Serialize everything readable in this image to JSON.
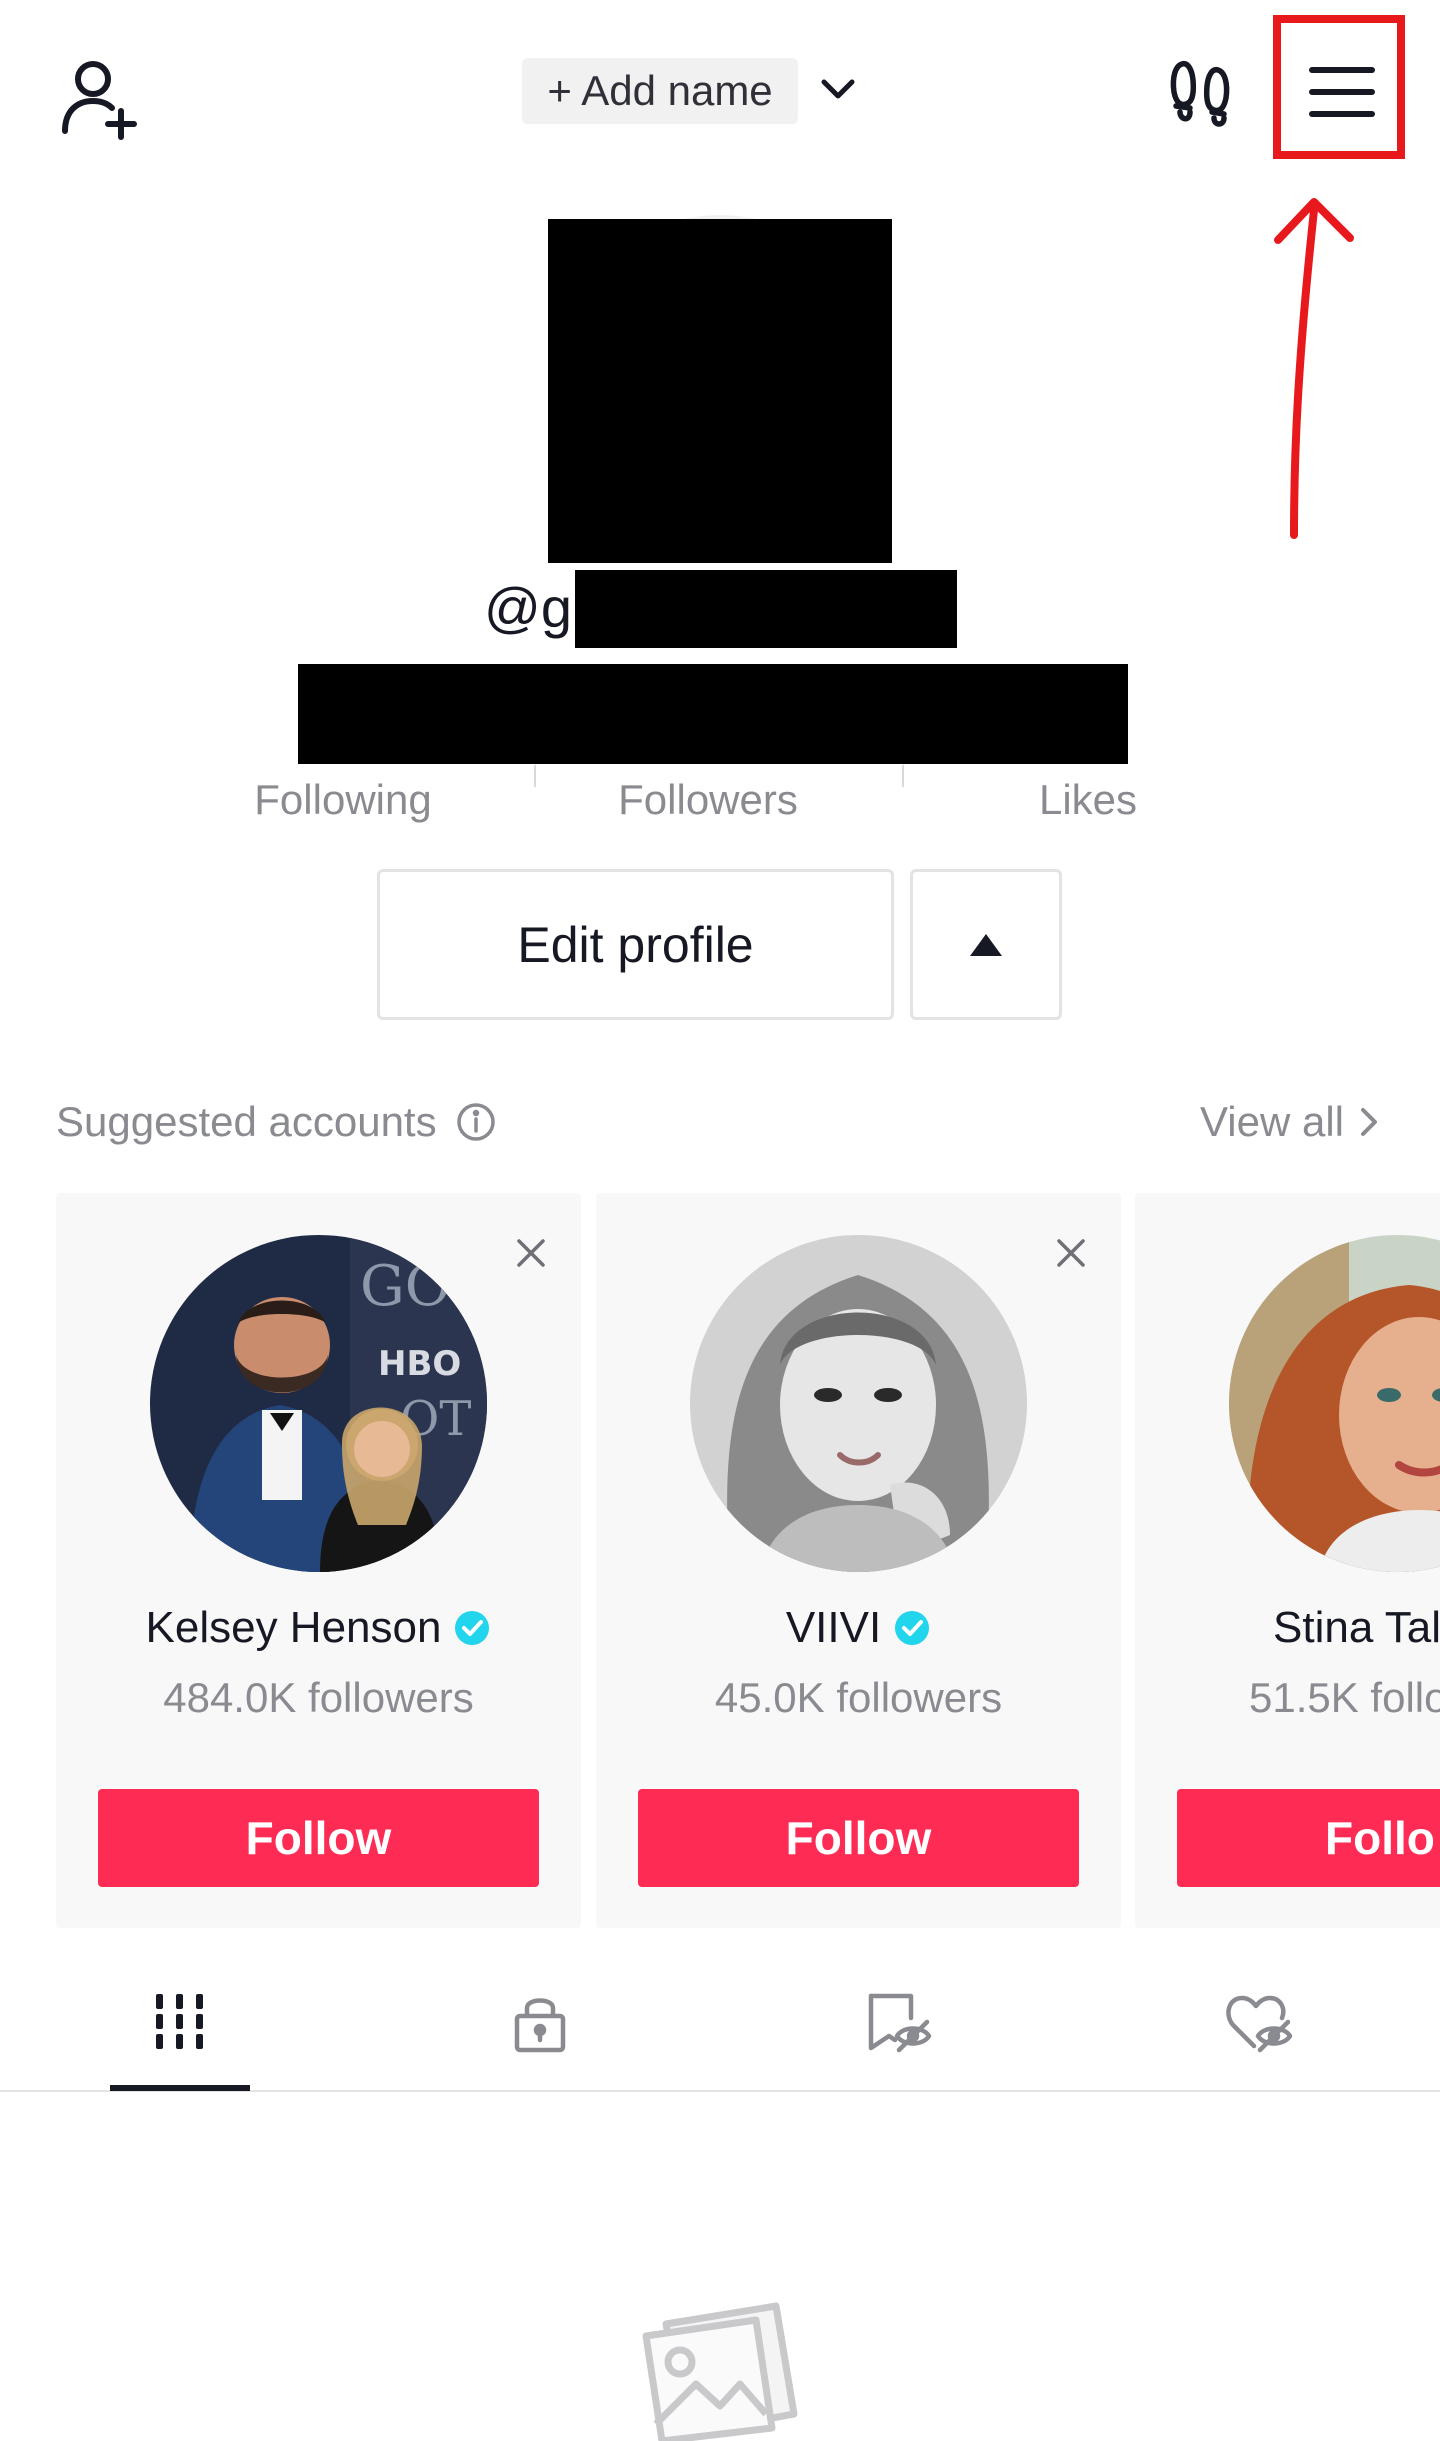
{
  "header": {
    "add_name_label": "+ Add name",
    "icons": [
      "add-user-icon",
      "chevron-down-icon",
      "footprint-icon",
      "menu-icon"
    ]
  },
  "annotation": {
    "highlight_color": "#e8191d"
  },
  "profile": {
    "username_visible": "@gu",
    "stats": {
      "following_label": "Following",
      "followers_label": "Followers",
      "likes_label": "Likes"
    },
    "edit_profile_label": "Edit profile"
  },
  "suggested": {
    "title": "Suggested accounts",
    "view_all_label": "View all",
    "accounts": [
      {
        "name": "Kelsey Henson",
        "verified": true,
        "followers": "484.0K followers",
        "follow_label": "Follow"
      },
      {
        "name": "VIIVI",
        "verified": true,
        "followers": "45.0K followers",
        "follow_label": "Follow"
      },
      {
        "name": "Stina Tal",
        "verified": false,
        "followers": "51.5K follo",
        "follow_label": "Follo"
      }
    ]
  },
  "tabs": {
    "items": [
      "videos-grid-icon",
      "private-lock-icon",
      "hidden-bookmark-icon",
      "hidden-liked-icon"
    ],
    "active_index": 0
  },
  "colors": {
    "accent": "#fe2c55",
    "verified": "#20d5ec",
    "muted_text": "#8a8b91"
  }
}
